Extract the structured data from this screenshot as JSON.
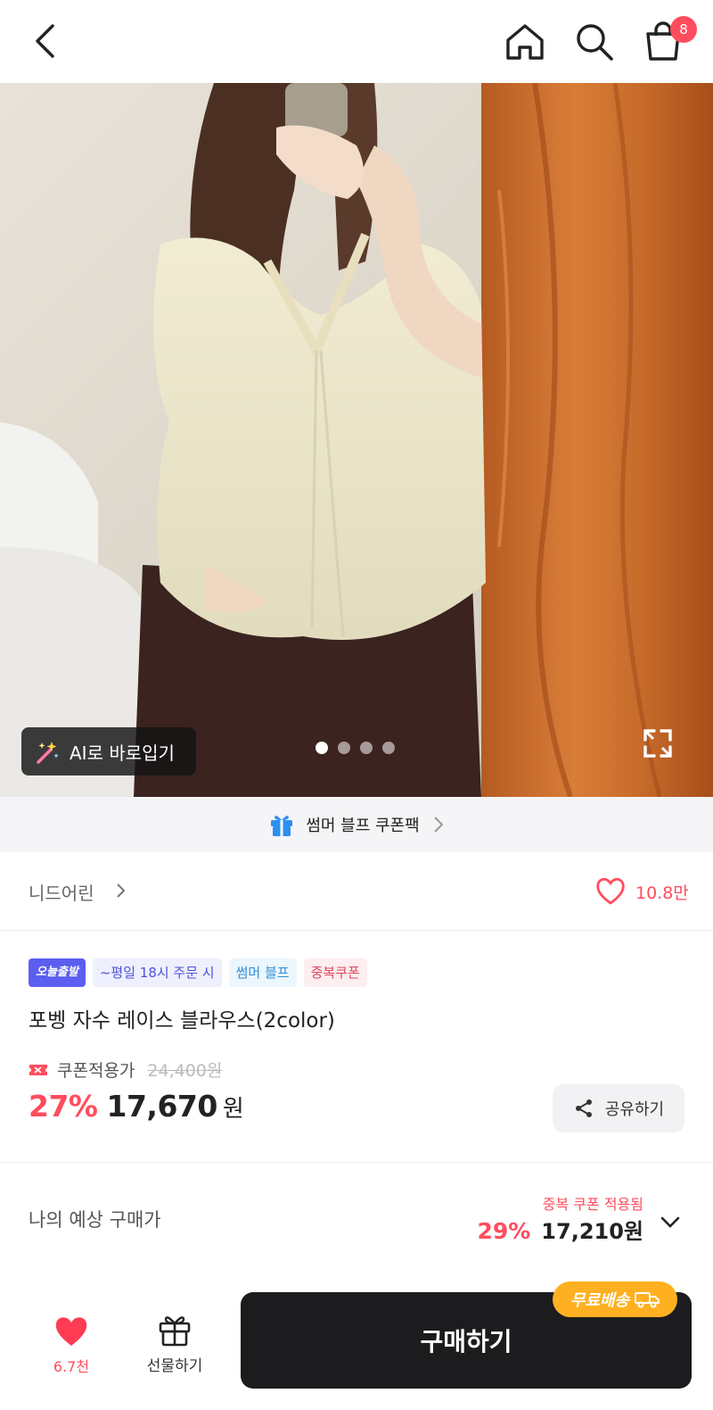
{
  "header": {
    "cart_count": "8",
    "icons": [
      "back-icon",
      "home-icon",
      "search-icon",
      "shopping-bag-icon"
    ]
  },
  "gallery": {
    "ai_button_label": "AI로 바로입기",
    "page_count": 4,
    "active_page": 1
  },
  "promo_banner": {
    "label": "썸머 블프 쿠폰팩"
  },
  "store": {
    "name": "니드어린",
    "like_count": "10.8만"
  },
  "tags": [
    {
      "label": "오늘출발",
      "style": "today"
    },
    {
      "label": "~평일 18시 주문 시",
      "style": "eta"
    },
    {
      "label": "썸머 블프",
      "style": "summer"
    },
    {
      "label": "중복쿠폰",
      "style": "dup"
    }
  ],
  "product": {
    "title": "포벵 자수 레이스 블라우스(2color)",
    "coupon_label": "쿠폰적용가",
    "original_price": "24,400원",
    "discount_rate": "27%",
    "price": "17,670",
    "currency": "원",
    "share_label": "공유하기"
  },
  "estimate": {
    "label": "나의 예상 구매가",
    "note": "중복 쿠폰 적용됨",
    "rate": "29%",
    "amount": "17,210원"
  },
  "bottom_bar": {
    "like_count": "6.7천",
    "gift_label": "선물하기",
    "buy_label": "구매하기",
    "free_shipping_label": "무료배송"
  },
  "colors": {
    "accent": "#ff4d5e",
    "buy_button": "#1c1c1e",
    "free_shipping": "#ffb020",
    "tag_today": "#5b5ef0"
  }
}
